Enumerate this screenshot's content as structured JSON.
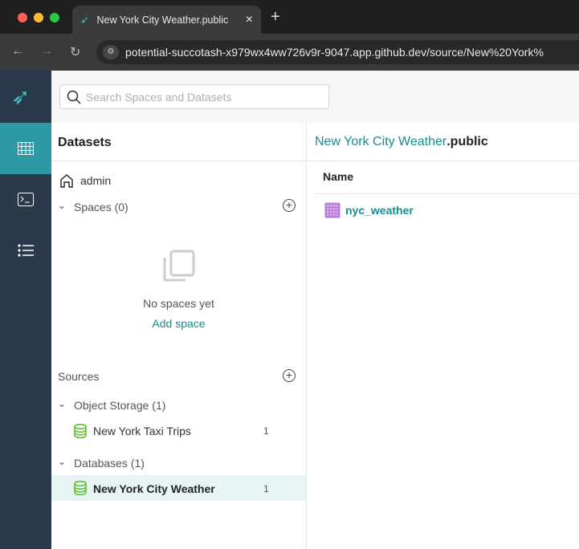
{
  "browser": {
    "tab_title": "New York City Weather.public",
    "new_tab": "+",
    "close": "×",
    "url": "potential-succotash-x979wx4ww726v9r-9047.app.github.dev/source/New%20York%"
  },
  "search": {
    "placeholder": "Search Spaces and Datasets"
  },
  "left": {
    "title": "Datasets",
    "home": "admin",
    "spaces": "Spaces (0)",
    "empty": "No spaces yet",
    "add_space": "Add space",
    "sources": "Sources",
    "groups": [
      {
        "label": "Object Storage (1)",
        "items": [
          {
            "name": "New York Taxi Trips",
            "count": "1"
          }
        ]
      },
      {
        "label": "Databases (1)",
        "items": [
          {
            "name": "New York City Weather",
            "count": "1"
          }
        ]
      }
    ]
  },
  "right": {
    "crumb_source": "New York City Weather",
    "crumb_schema": ".public",
    "col_name": "Name",
    "rows": [
      {
        "name": "nyc_weather"
      }
    ]
  },
  "colors": {
    "accent": "#1b8a8f",
    "nav": "#2a3a4a",
    "active": "#2f98a5"
  }
}
